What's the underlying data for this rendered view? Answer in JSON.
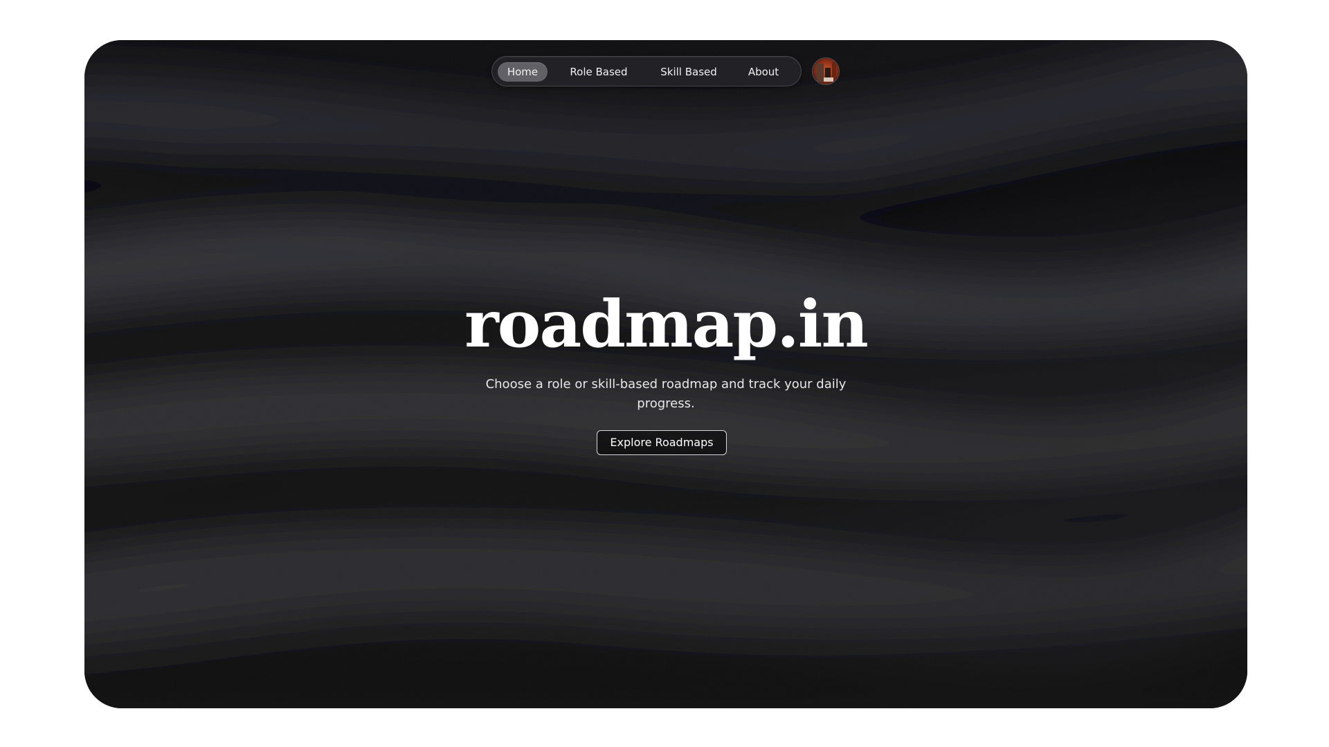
{
  "nav": {
    "items": [
      {
        "label": "Home",
        "active": true
      },
      {
        "label": "Role Based",
        "active": false
      },
      {
        "label": "Skill Based",
        "active": false
      },
      {
        "label": "About",
        "active": false
      }
    ]
  },
  "avatar": {
    "icon": "user-avatar"
  },
  "hero": {
    "title": "roadmap.in",
    "subtitle": "Choose a role or skill-based roadmap and track your daily progress.",
    "cta_label": "Explore Roadmaps"
  },
  "colors": {
    "background": "#0b0b0d",
    "text": "#ffffff",
    "nav_active": "#8f8f95"
  }
}
